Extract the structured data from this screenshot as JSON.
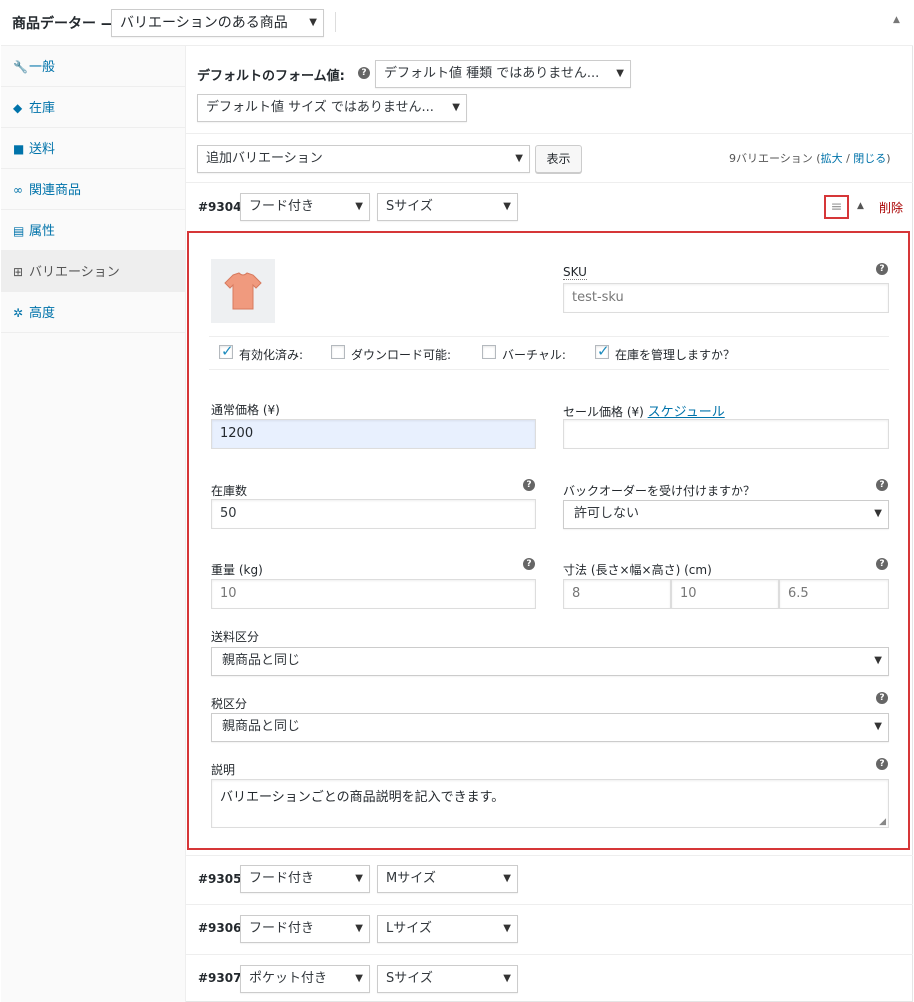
{
  "header": {
    "title": "商品データー —",
    "product_type": "バリエーションのある商品",
    "collapse_glyph": "▲"
  },
  "tabs": [
    {
      "label": "一般",
      "icon": "wrench-icon",
      "glyph": "🔧"
    },
    {
      "label": "在庫",
      "icon": "tag-icon",
      "glyph": "◆"
    },
    {
      "label": "送料",
      "icon": "truck-icon",
      "glyph": "■"
    },
    {
      "label": "関連商品",
      "icon": "link-icon",
      "glyph": "∞"
    },
    {
      "label": "属性",
      "icon": "list-icon",
      "glyph": "▤"
    },
    {
      "label": "バリエーション",
      "icon": "grid-icon",
      "glyph": "⊞"
    },
    {
      "label": "高度",
      "icon": "gear-icon",
      "glyph": "✲"
    }
  ],
  "defaults": {
    "label": "デフォルトのフォーム値:",
    "type_select": "デフォルト値 種類 ではありません...",
    "size_select": "デフォルト値 サイズ ではありません..."
  },
  "bulk": {
    "action_select": "追加バリエーション",
    "show_button": "表示",
    "count_text": "9バリエーション (",
    "expand_link": "拡大",
    "separator": " / ",
    "close_link": "閉じる",
    "count_close": ")"
  },
  "variation_main": {
    "id": "#9304",
    "attr1": "フード付き",
    "attr2": "Sサイズ",
    "delete_label": "削除",
    "expand_glyph": "▲",
    "menu_glyph": "≡",
    "sku_label": "SKU",
    "sku_placeholder": "test-sku",
    "checkboxes": [
      {
        "label": "有効化済み:",
        "checked": true
      },
      {
        "label": "ダウンロード可能:",
        "checked": false
      },
      {
        "label": "バーチャル:",
        "checked": false
      },
      {
        "label": "在庫を管理しますか？",
        "checked": true
      }
    ],
    "regular_price_label": "通常価格 (¥)",
    "regular_price_value": "1200",
    "sale_price_label": "セール価格 (¥) ",
    "schedule_link": "スケジュール",
    "sale_price_value": "",
    "stock_label": "在庫数",
    "stock_value": "50",
    "backorder_label": "バックオーダーを受け付けますか？",
    "backorder_value": "許可しない",
    "weight_label": "重量 (kg)",
    "weight_placeholder": "10",
    "dims_label": "寸法 (長さ×幅×高さ) (cm)",
    "dims": [
      "8",
      "10",
      "6.5"
    ],
    "shipping_label": "送料区分",
    "shipping_value": "親商品と同じ",
    "tax_label": "税区分",
    "tax_value": "親商品と同じ",
    "desc_label": "説明",
    "desc_value": "バリエーションごとの商品説明を記入できます。",
    "help_glyph": "?"
  },
  "other_variations": [
    {
      "id": "#9305",
      "attr1": "フード付き",
      "attr2": "Mサイズ"
    },
    {
      "id": "#9306",
      "attr1": "フード付き",
      "attr2": "Lサイズ"
    },
    {
      "id": "#9307",
      "attr1": "ポケット付き",
      "attr2": "Sサイズ"
    }
  ],
  "colors": {
    "accent": "#0073aa",
    "highlight": "#d63638",
    "delete": "#a00"
  }
}
